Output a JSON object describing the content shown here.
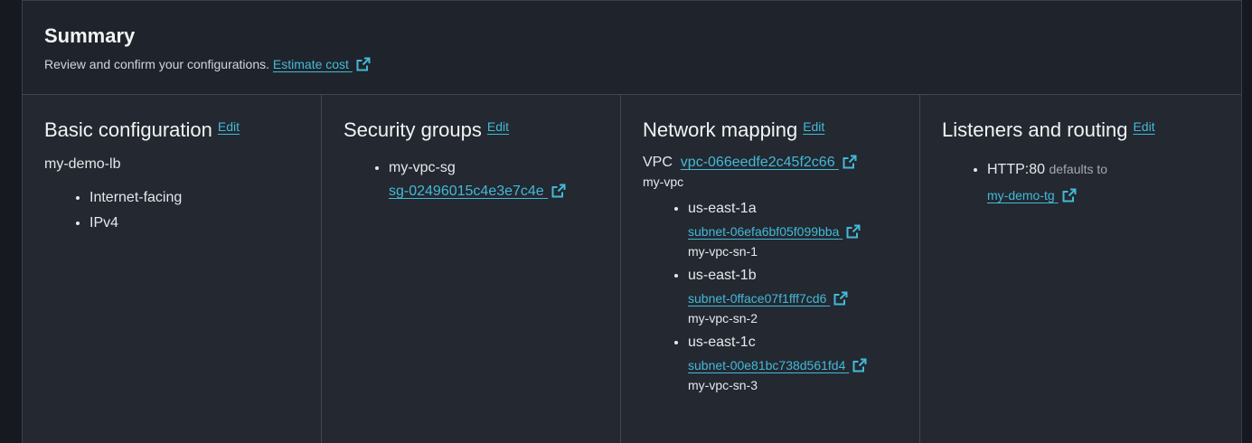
{
  "summary": {
    "title": "Summary",
    "description": "Review and confirm your configurations.",
    "estimate_link": "Estimate cost"
  },
  "basic": {
    "title": "Basic configuration",
    "edit": "Edit",
    "name": "my-demo-lb",
    "items": [
      "Internet-facing",
      "IPv4"
    ]
  },
  "security": {
    "title": "Security groups",
    "edit": "Edit",
    "group_name": "my-vpc-sg",
    "group_id": "sg-02496015c4e3e7c4e"
  },
  "network": {
    "title": "Network mapping",
    "edit": "Edit",
    "vpc_label": "VPC",
    "vpc_id": "vpc-066eedfe2c45f2c66",
    "vpc_name": "my-vpc",
    "zones": [
      {
        "zone": "us-east-1a",
        "subnet_id": "subnet-06efa6bf05f099bba",
        "subnet_name": "my-vpc-sn-1"
      },
      {
        "zone": "us-east-1b",
        "subnet_id": "subnet-0fface07f1fff7cd6",
        "subnet_name": "my-vpc-sn-2"
      },
      {
        "zone": "us-east-1c",
        "subnet_id": "subnet-00e81bc738d561fd4",
        "subnet_name": "my-vpc-sn-3"
      }
    ]
  },
  "listeners": {
    "title": "Listeners and routing",
    "edit": "Edit",
    "protocol": "HTTP:80",
    "defaults_text": "defaults to",
    "target_group": "my-demo-tg"
  },
  "colors": {
    "link": "#44b9d6",
    "panel_bg": "#232831",
    "header_bg": "#1f242c",
    "page_bg": "#16191f"
  }
}
